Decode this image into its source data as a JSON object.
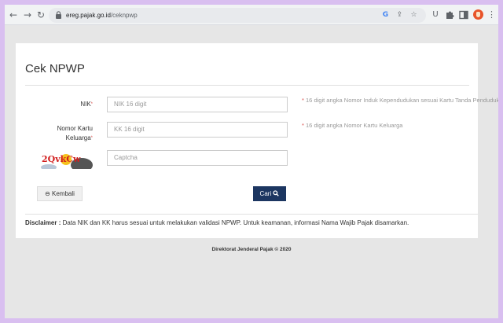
{
  "browser": {
    "url_host": "ereg.pajak.go.id",
    "url_path": "/ceknpwp",
    "icons": [
      "back-arrow-icon",
      "forward-arrow-icon",
      "reload-icon",
      "lock-icon",
      "google-icon",
      "share-icon",
      "bookmark-star-icon",
      "extension-u-icon",
      "puzzle-icon",
      "sidebar-icon",
      "profile-avatar-icon",
      "kebab-menu-icon"
    ],
    "back_glyph": "←",
    "forward_glyph": "→",
    "reload_glyph": "↻",
    "google_glyph": "G",
    "share_glyph": "⇪",
    "star_glyph": "☆",
    "u_glyph": "U",
    "menu_glyph": "⋮"
  },
  "form": {
    "title": "Cek NPWP",
    "nik_label": "NIK",
    "nik_placeholder": "NIK 16 digit",
    "nik_hint": "16 digit angka Nomor Induk Kependudukan sesuai Kartu Tanda Penduduk",
    "kk_label_line1": "Nomor Kartu",
    "kk_label_line2": "Keluarga",
    "kk_placeholder": "KK 16 digit",
    "kk_hint": "16 digit angka Nomor Kartu Keluarga",
    "required_mark": "*",
    "captcha_placeholder": "Captcha",
    "captcha_text": "2QvkCw",
    "back_label": "Kembali",
    "search_label": "Cari",
    "disclaimer_label": "Disclaimer :",
    "disclaimer_text": "Data NIK dan KK harus sesuai untuk melakukan validasi NPWP. Untuk keamanan, informasi Nama Wajib Pajak disamarkan.",
    "accent_color": "#1c3661"
  },
  "footer": {
    "text": "Direktorat Jenderal Pajak © 2020"
  }
}
